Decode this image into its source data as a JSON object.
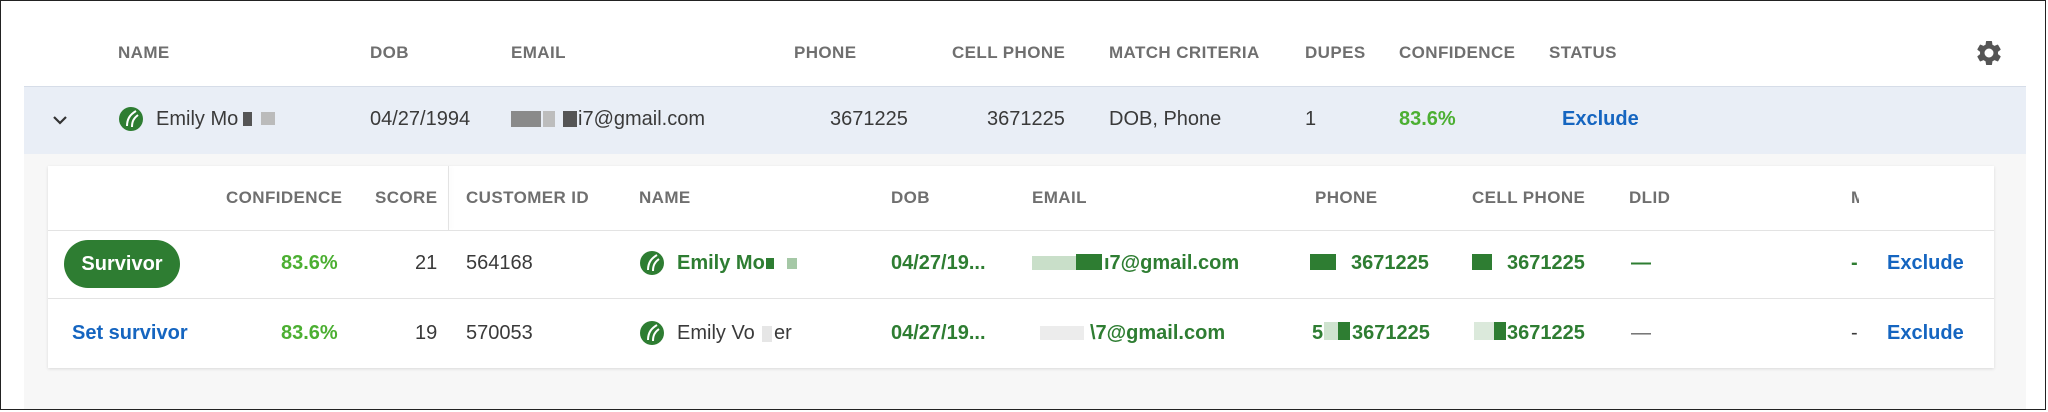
{
  "main_table": {
    "headers": [
      "NAME",
      "DOB",
      "EMAIL",
      "PHONE",
      "CELL PHONE",
      "MATCH CRITERIA",
      "DUPES",
      "CONFIDENCE",
      "STATUS"
    ],
    "row": {
      "name": "Emily Mo",
      "dob": "04/27/1994",
      "email": "i7@gmail.com",
      "phone": "3671225",
      "cell_phone": "3671225",
      "match_criteria": "DOB, Phone",
      "dupes": "1",
      "confidence": "83.6%",
      "status": "Exclude"
    }
  },
  "sub_table": {
    "headers": [
      "CONFIDENCE",
      "SCORE",
      "CUSTOMER ID",
      "NAME",
      "DOB",
      "EMAIL",
      "PHONE",
      "CELL PHONE",
      "DLID",
      "M"
    ],
    "rows": [
      {
        "action": "Survivor",
        "confidence": "83.6%",
        "score": "21",
        "customer_id": "564168",
        "name": "Emily Mo",
        "dob": "04/27/19...",
        "email": "ı7@gmail.com",
        "phone": "3671225",
        "cell_phone": "3671225",
        "dlid": "—",
        "m": "-",
        "status": "Exclude"
      },
      {
        "action": "Set survivor",
        "confidence": "83.6%",
        "score": "19",
        "customer_id": "570053",
        "name": "Emily Vo",
        "name_tail": "er",
        "dob": "04/27/19...",
        "email": "\\7@gmail.com",
        "phone_prefix": "5",
        "phone": "3671225",
        "cell_phone": "3671225",
        "dlid": "—",
        "m": "-",
        "status": "Exclude"
      }
    ]
  },
  "icons": {
    "settings": "gear-icon",
    "expand": "chevron-down-icon",
    "brand": "leaf-icon"
  },
  "colors": {
    "accent_green": "#2e7d32",
    "confidence_green": "#4caf32",
    "link_blue": "#1565c0",
    "row_highlight": "#e9eef6"
  }
}
